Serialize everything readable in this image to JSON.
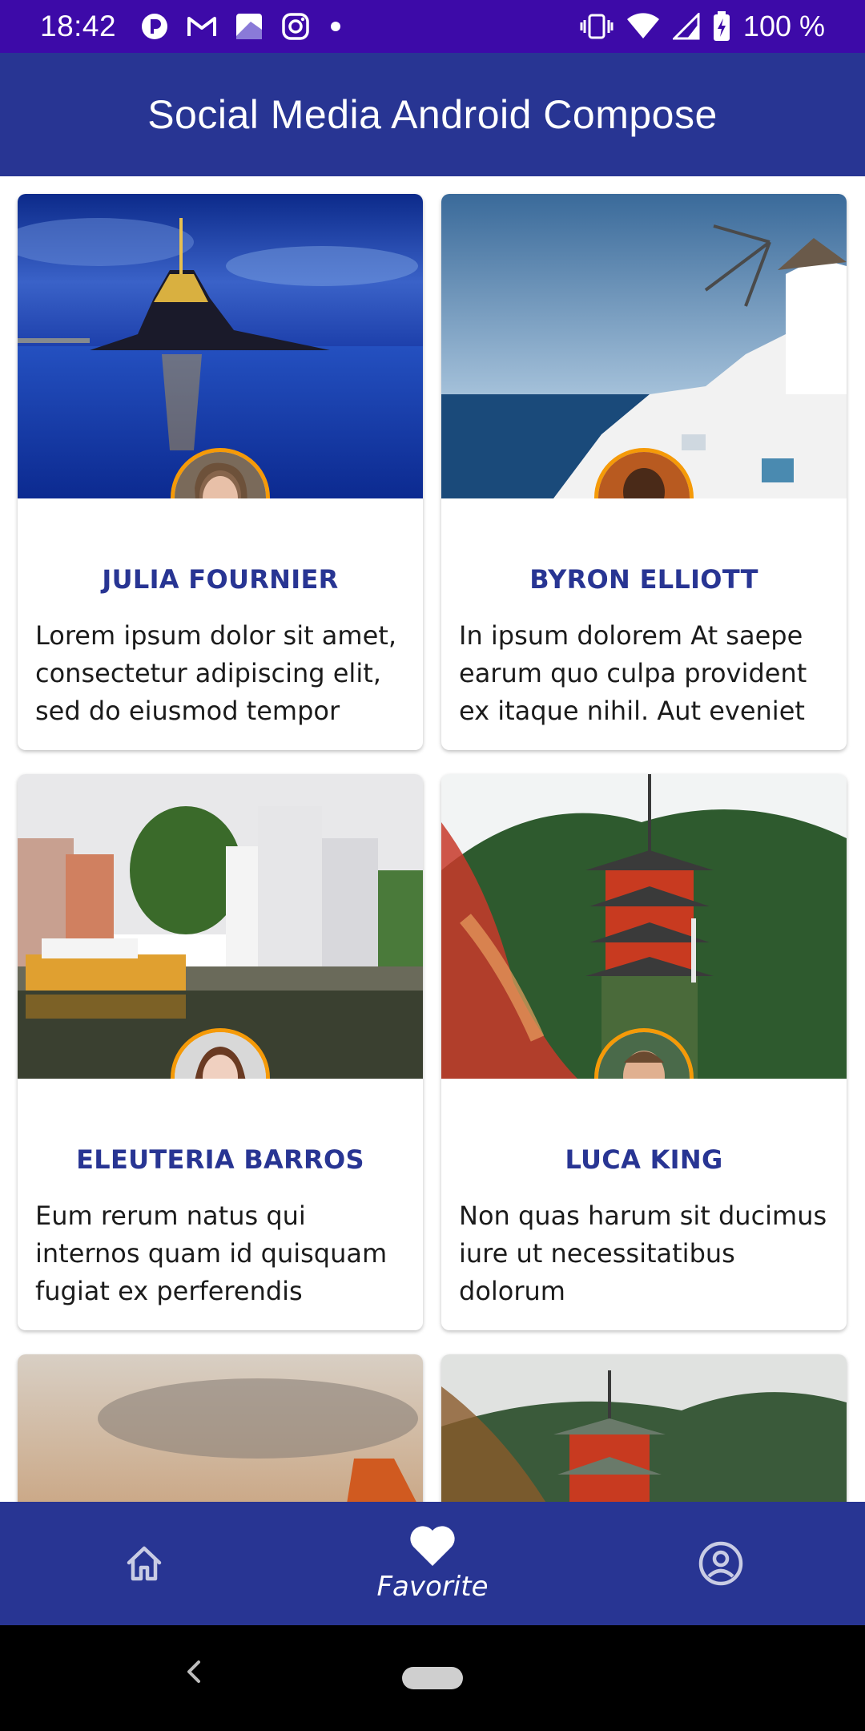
{
  "status_bar": {
    "time": "18:42",
    "battery": "100 %",
    "icons_left": [
      "app-notification-icon",
      "gmail-icon",
      "gallery-icon",
      "instagram-icon",
      "dot-icon"
    ],
    "icons_right": [
      "vibrate-icon",
      "wifi-icon",
      "signal-icon",
      "battery-charging-icon"
    ]
  },
  "app_bar": {
    "title": "Social Media Android Compose"
  },
  "cards": [
    {
      "name": "JULIA FOURNIER",
      "description": "Lorem ipsum dolor sit amet, consectetur adipiscing elit, sed do eiusmod tempor"
    },
    {
      "name": "BYRON ELLIOTT",
      "description": "In ipsum dolorem At saepe earum quo culpa provident ex itaque nihil. Aut eveniet"
    },
    {
      "name": "ELEUTERIA BARROS",
      "description": "Eum rerum natus qui internos quam id quisquam fugiat ex perferendis"
    },
    {
      "name": "LUCA KING",
      "description": "Non quas harum sit ducimus iure ut necessitatibus dolorum"
    },
    {
      "name": "",
      "description": ""
    },
    {
      "name": "",
      "description": ""
    }
  ],
  "bottom_nav": {
    "items": [
      {
        "icon": "home-icon",
        "label": ""
      },
      {
        "icon": "heart-icon",
        "label": "Favorite"
      },
      {
        "icon": "profile-icon",
        "label": ""
      }
    ]
  },
  "colors": {
    "status_bar": "#3d0aa8",
    "primary": "#283593",
    "avatar_border": "#f59a08"
  }
}
